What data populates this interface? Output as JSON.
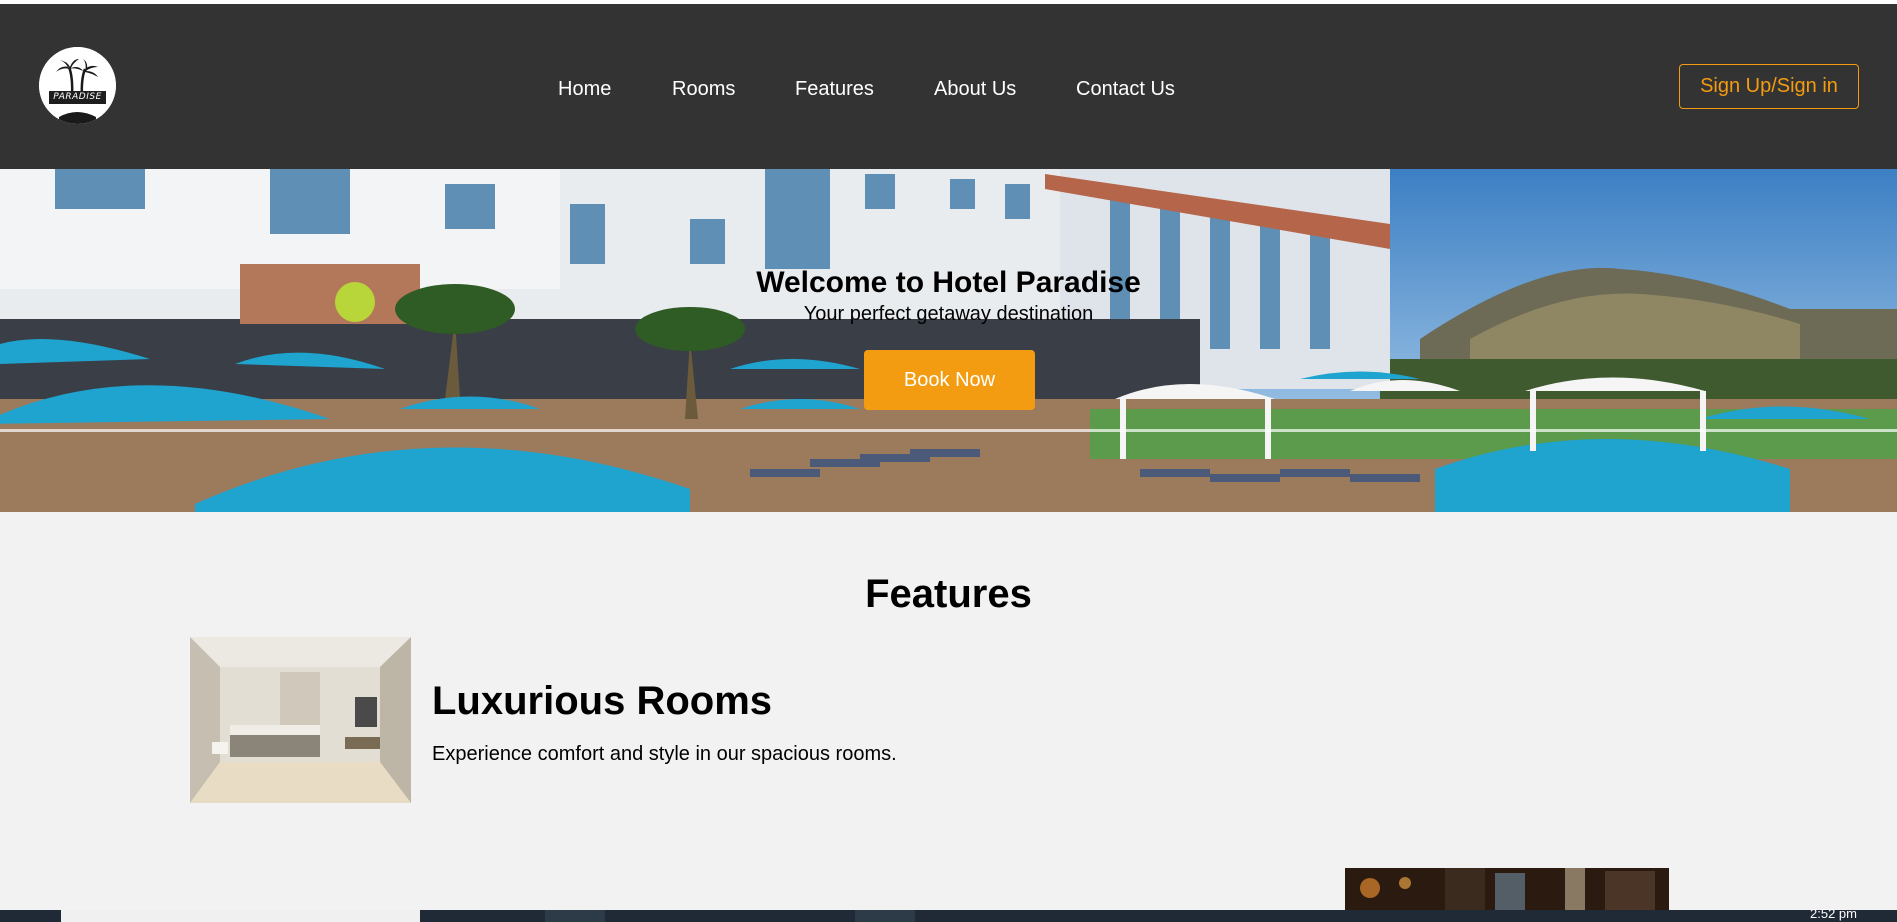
{
  "header": {
    "logo_text": "PARADISE",
    "nav": [
      {
        "label": "Home"
      },
      {
        "label": "Rooms"
      },
      {
        "label": "Features"
      },
      {
        "label": "About Us"
      },
      {
        "label": "Contact Us"
      }
    ],
    "signin_label": "Sign Up/Sign in"
  },
  "hero": {
    "title": "Welcome to Hotel Paradise",
    "subtitle": "Your perfect getaway destination",
    "cta_label": "Book Now"
  },
  "features": {
    "heading": "Features",
    "items": [
      {
        "title": "Luxurious Rooms",
        "description": "Experience comfort and style in our spacious rooms."
      }
    ]
  },
  "taskbar": {
    "clock": "2:52 pm"
  },
  "colors": {
    "nav_bg": "#333333",
    "accent": "#f39c12",
    "page_bg": "#f2f2f2",
    "umbrella": "#1fa3cf"
  }
}
